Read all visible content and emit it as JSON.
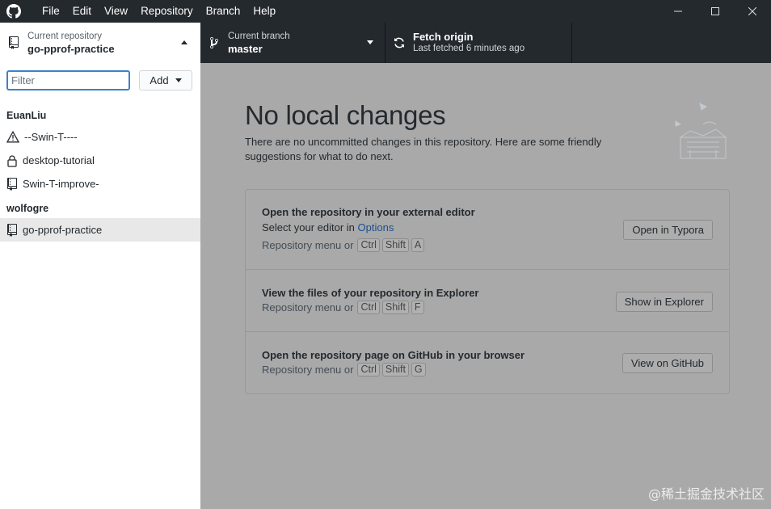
{
  "menu": [
    "File",
    "Edit",
    "View",
    "Repository",
    "Branch",
    "Help"
  ],
  "toolbar": {
    "repo_label": "Current repository",
    "repo_value": "go-pprof-practice",
    "branch_label": "Current branch",
    "branch_value": "master",
    "fetch_label": "Fetch origin",
    "fetch_sub": "Last fetched 6 minutes ago"
  },
  "sidebar": {
    "filter_placeholder": "Filter",
    "add_label": "Add",
    "groups": [
      {
        "name": "EuanLiu",
        "repos": [
          {
            "name": "--Swin-T----",
            "icon": "warning-icon"
          },
          {
            "name": "desktop-tutorial",
            "icon": "lock-icon"
          },
          {
            "name": "Swin-T-improve-",
            "icon": "repo-icon"
          }
        ]
      },
      {
        "name": "wolfogre",
        "repos": [
          {
            "name": "go-pprof-practice",
            "icon": "repo-icon",
            "selected": true
          }
        ]
      }
    ]
  },
  "main": {
    "headline": "No local changes",
    "subtext": "There are no uncommitted changes in this repository. Here are some friendly suggestions for what to do next.",
    "suggestions": [
      {
        "title": "Open the repository in your external editor",
        "desc_prefix": "Select your editor in ",
        "desc_link": "Options",
        "menu_text": "Repository menu or",
        "keys": [
          "Ctrl",
          "Shift",
          "A"
        ],
        "button": "Open in Typora"
      },
      {
        "title": "View the files of your repository in Explorer",
        "menu_text": "Repository menu or",
        "keys": [
          "Ctrl",
          "Shift",
          "F"
        ],
        "button": "Show in Explorer"
      },
      {
        "title": "Open the repository page on GitHub in your browser",
        "menu_text": "Repository menu or",
        "keys": [
          "Ctrl",
          "Shift",
          "G"
        ],
        "button": "View on GitHub"
      }
    ]
  },
  "watermark": "@稀土掘金技术社区",
  "colors": {
    "titlebar": "#24292e",
    "overlay": "#a9a9a9",
    "filter_border": "#3b82c9",
    "link": "#1c4f8f"
  }
}
